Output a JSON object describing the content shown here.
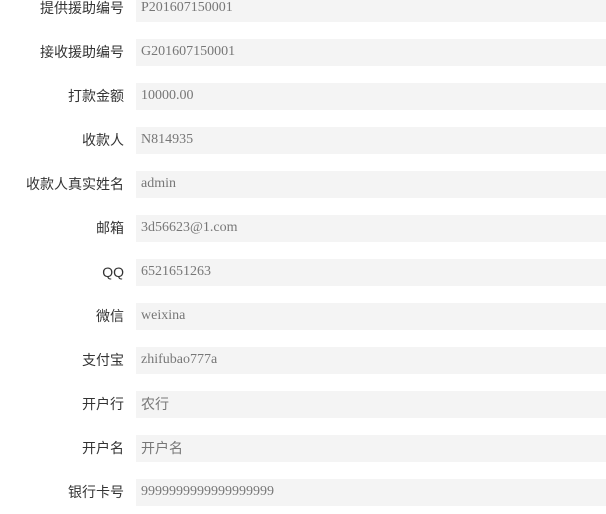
{
  "fields": [
    {
      "label": "提供援助编号",
      "value": "P201607150001"
    },
    {
      "label": "接收援助编号",
      "value": "G201607150001"
    },
    {
      "label": "打款金额",
      "value": "10000.00"
    },
    {
      "label": "收款人",
      "value": "N814935"
    },
    {
      "label": "收款人真实姓名",
      "value": "admin"
    },
    {
      "label": "邮箱",
      "value": "3d56623@1.com"
    },
    {
      "label": "QQ",
      "value": "6521651263"
    },
    {
      "label": "微信",
      "value": "weixina"
    },
    {
      "label": "支付宝",
      "value": "zhifubao777a"
    },
    {
      "label": "开户行",
      "value": "农行"
    },
    {
      "label": "开户名",
      "value": "开户名"
    },
    {
      "label": "银行卡号",
      "value": "9999999999999999999"
    }
  ]
}
